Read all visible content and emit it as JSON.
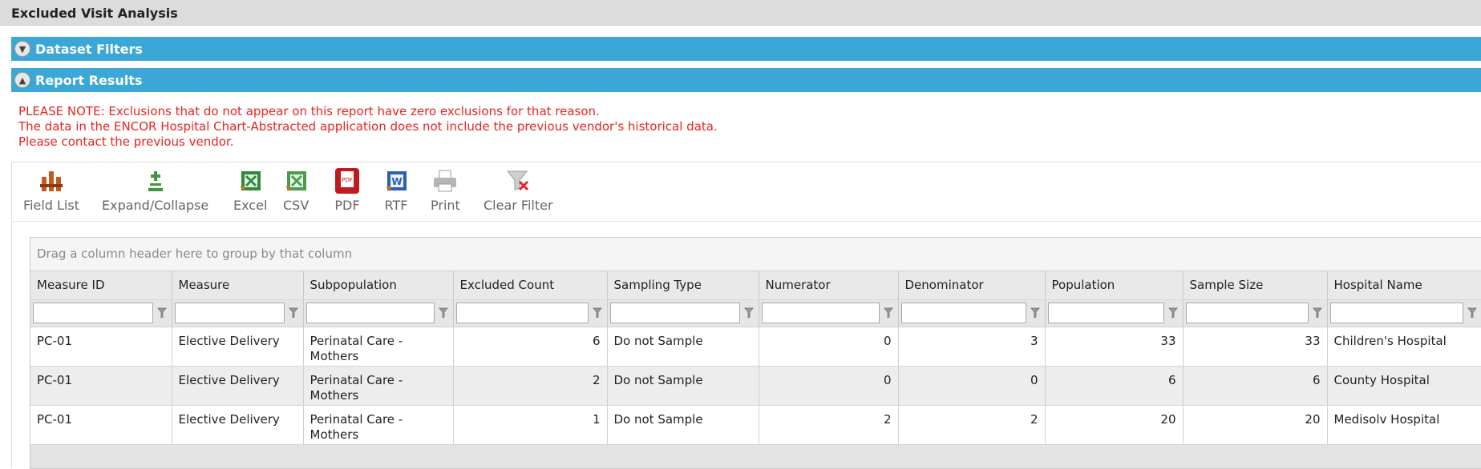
{
  "page": {
    "title": "Excluded Visit Analysis"
  },
  "sections": {
    "dataset_filters": "Dataset Filters",
    "report_results": "Report Results"
  },
  "notes": [
    "PLEASE NOTE: Exclusions that do not appear on this report have zero exclusions for that reason.",
    "The data in the ENCOR Hospital Chart-Abstracted application does not include the previous vendor's historical data.",
    "Please contact the previous vendor."
  ],
  "toolbar": {
    "field_list": "Field List",
    "expand_collapse": "Expand/Collapse",
    "excel": "Excel",
    "csv": "CSV",
    "pdf": "PDF",
    "rtf": "RTF",
    "print": "Print",
    "clear_filter": "Clear Filter"
  },
  "grid": {
    "group_panel": "Drag a column header here to group by that column",
    "columns": [
      "Measure ID",
      "Measure",
      "Subpopulation",
      "Excluded Count",
      "Sampling Type",
      "Numerator",
      "Denominator",
      "Population",
      "Sample Size",
      "Hospital Name"
    ],
    "rows": [
      {
        "measure_id": "PC-01",
        "measure": "Elective Delivery",
        "subpopulation": "Perinatal Care - Mothers",
        "excluded_count": "6",
        "sampling_type": "Do not Sample",
        "numerator": "0",
        "denominator": "3",
        "population": "33",
        "sample_size": "33",
        "hospital": "Children's Hospital"
      },
      {
        "measure_id": "PC-01",
        "measure": "Elective Delivery",
        "subpopulation": "Perinatal Care - Mothers",
        "excluded_count": "2",
        "sampling_type": "Do not Sample",
        "numerator": "0",
        "denominator": "0",
        "population": "6",
        "sample_size": "6",
        "hospital": "County Hospital"
      },
      {
        "measure_id": "PC-01",
        "measure": "Elective Delivery",
        "subpopulation": "Perinatal Care - Mothers",
        "excluded_count": "1",
        "sampling_type": "Do not Sample",
        "numerator": "2",
        "denominator": "2",
        "population": "20",
        "sample_size": "20",
        "hospital": "Medisolv Hospital"
      }
    ]
  },
  "colors": {
    "section_bar": "#3ba7d6",
    "note_text": "#e8231f",
    "link": "#1a1acc"
  }
}
